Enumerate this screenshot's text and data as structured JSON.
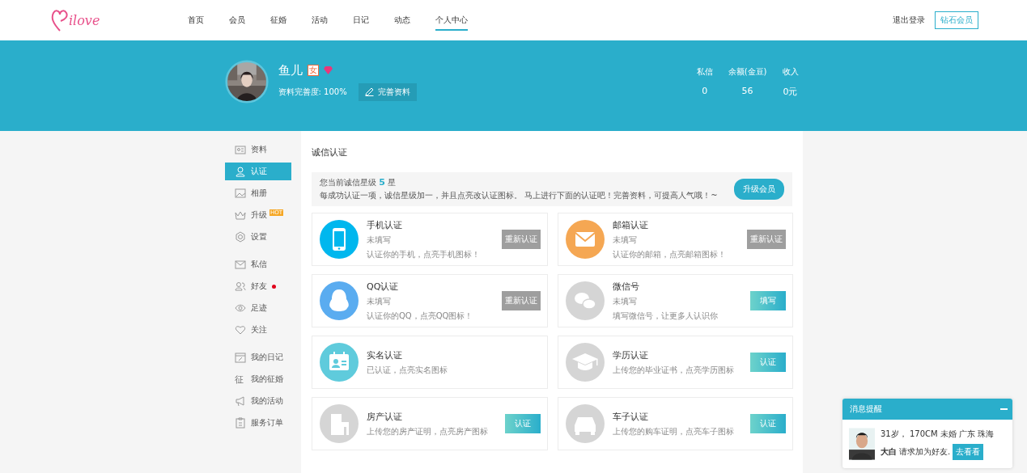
{
  "header": {
    "logo": "ilove",
    "nav": [
      {
        "label": "首页",
        "selected": false
      },
      {
        "label": "会员",
        "selected": false
      },
      {
        "label": "征婚",
        "selected": false
      },
      {
        "label": "活动",
        "selected": false
      },
      {
        "label": "日记",
        "selected": false
      },
      {
        "label": "动态",
        "selected": false
      },
      {
        "label": "个人中心",
        "selected": true
      }
    ],
    "logout": "退出登录",
    "vip_button": "钻石会员"
  },
  "profile": {
    "name": "鱼儿",
    "gender_badge": "女",
    "completeness": "资料完善度: 100%",
    "edit_button": "完善资料",
    "stats": [
      {
        "label": "私信",
        "value": "0"
      },
      {
        "label": "余额(金豆)",
        "value": "56"
      },
      {
        "label": "收入",
        "value": "0元"
      }
    ]
  },
  "sidebar": {
    "groups": [
      [
        {
          "label": "资料",
          "selected": false
        },
        {
          "label": "认证",
          "selected": true
        },
        {
          "label": "相册",
          "selected": false
        },
        {
          "label": "升级",
          "selected": false,
          "badge": "HOT"
        },
        {
          "label": "设置",
          "selected": false
        }
      ],
      [
        {
          "label": "私信",
          "selected": false
        },
        {
          "label": "好友",
          "selected": false,
          "dot": true
        },
        {
          "label": "足迹",
          "selected": false
        },
        {
          "label": "关注",
          "selected": false
        }
      ],
      [
        {
          "label": "我的日记",
          "selected": false
        },
        {
          "label": "我的征婚",
          "selected": false,
          "glyph": "征"
        },
        {
          "label": "我的活动",
          "selected": false
        },
        {
          "label": "服务订单",
          "selected": false
        }
      ]
    ]
  },
  "content": {
    "title": "诚信认证",
    "notice": {
      "prefix": "您当前诚信星级",
      "stars": "5",
      "suffix": "星",
      "text": "每成功认证一项，诚信星级加一，并且点亮改认证图标。 马上进行下面的认证吧！完善资料，可提高人气哦！~",
      "button": "升级会员"
    },
    "cards": [
      {
        "title": "手机认证",
        "status": "未填写",
        "desc": "认证你的手机，点亮手机图标！",
        "color": "#00b7ee",
        "button": {
          "label": "重新认证",
          "kind": "gray"
        }
      },
      {
        "title": "邮箱认证",
        "status": "未填写",
        "desc": "认证你的邮箱，点亮邮箱图标！",
        "color": "#f5a753",
        "button": {
          "label": "重新认证",
          "kind": "gray"
        }
      },
      {
        "title": "QQ认证",
        "status": "未填写",
        "desc": "认证你的QQ，点亮QQ图标！",
        "color": "#5aacf0",
        "button": {
          "label": "重新认证",
          "kind": "gray"
        }
      },
      {
        "title": "微信号",
        "status": "未填写",
        "desc": "填写微信号，让更多人认识你",
        "color": "#d5d5d5",
        "button": {
          "label": "填写",
          "kind": "teal"
        }
      },
      {
        "title": "实名认证",
        "desc": "已认证，点亮实名图标",
        "color": "#5fcbdc"
      },
      {
        "title": "学历认证",
        "desc": "上传您的毕业证书，点亮学历图标",
        "color": "#d5d5d5",
        "button": {
          "label": "认证",
          "kind": "teal"
        }
      },
      {
        "title": "房产认证",
        "desc": "上传您的房产证明，点亮房产图标",
        "color": "#d5d5d5",
        "button": {
          "label": "认证",
          "kind": "teal"
        }
      },
      {
        "title": "车子认证",
        "desc": "上传您的购车证明，点亮车子图标",
        "color": "#d5d5d5",
        "button": {
          "label": "认证",
          "kind": "teal"
        }
      }
    ]
  },
  "popup": {
    "title": "消息提醒",
    "info": "31岁， 170CM 未婚 广东 珠海",
    "sender": "大白",
    "message": "请求加为好友.",
    "button": "去看看"
  }
}
